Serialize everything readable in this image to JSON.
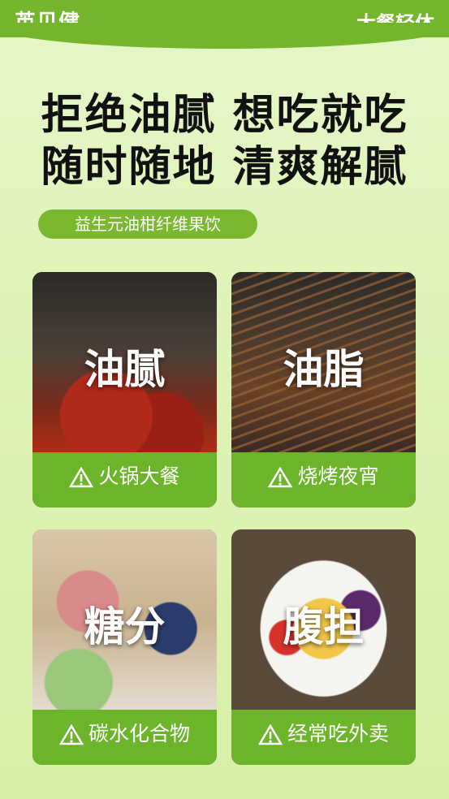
{
  "header": {
    "brand_left": "英贝健",
    "brand_right": "大餐轻体"
  },
  "headline": {
    "line1": "拒绝油腻 想吃就吃",
    "line2": "随时随地 清爽解腻"
  },
  "tag": "益生元油柑纤维果饮",
  "cards": [
    {
      "title": "油腻",
      "warning": "火锅大餐"
    },
    {
      "title": "油脂",
      "warning": "烧烤夜宵"
    },
    {
      "title": "糖分",
      "warning": "碳水化合物"
    },
    {
      "title": "腹担",
      "warning": "经常吃外卖"
    }
  ],
  "colors": {
    "accent": "#74b62b",
    "card_bottom": "#6cb42a",
    "headline": "#111111"
  }
}
